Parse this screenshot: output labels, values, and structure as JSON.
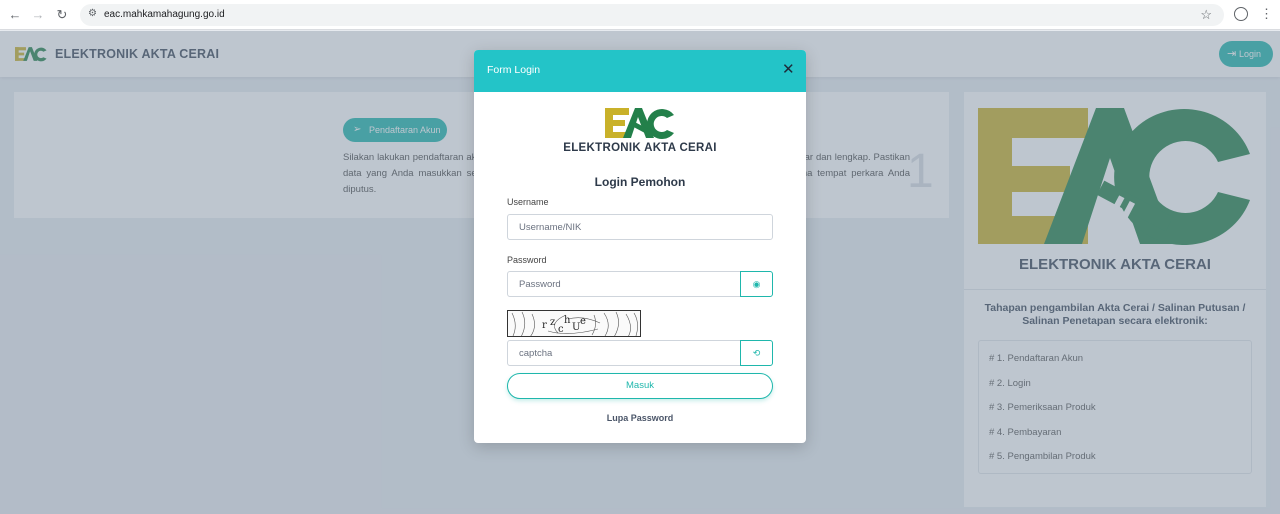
{
  "browser": {
    "url": "eac.mahkamahagung.go.id"
  },
  "header": {
    "title": "ELEKTRONIK AKTA CERAI",
    "login_label": "Login"
  },
  "registration_card": {
    "button_label": "Pendaftaran Akun",
    "text": "Silakan lakukan pendaftaran akun terlebih dahulu dengan mengisi dan melengkapi data diri Anda secara benar dan lengkap. Pastikan data yang Anda masukkan sesuai dengan data yang terdaftar di Mahkamah Syar'iyah/Pengadilan Agama tempat perkara Anda diputus.",
    "step_number": "1"
  },
  "side_card": {
    "logo_title": "ELEKTRONIK AKTA CERAI",
    "steps_heading": "Tahapan pengambilan Akta Cerai / Salinan Putusan / Salinan Penetapan secara elektronik:",
    "steps": [
      "# 1. Pendaftaran Akun",
      "# 2. Login",
      "# 3. Pemeriksaan Produk",
      "# 4. Pembayaran",
      "# 5. Pengambilan Produk"
    ]
  },
  "modal": {
    "title": "Form Login",
    "close_symbol": "✕",
    "brand": "ELEKTRONIK AKTA CERAI",
    "heading": "Login Pemohon",
    "username_label": "Username",
    "username_placeholder": "Username/NIK",
    "password_label": "Password",
    "password_placeholder": "Password",
    "captcha_placeholder": "captcha",
    "submit_label": "Masuk",
    "forgot_label": "Lupa Password"
  },
  "icons": {
    "back": "back-arrow-icon",
    "forward": "forward-arrow-icon",
    "reload": "reload-icon",
    "site_settings": "site-settings-icon",
    "bookmark": "star-icon",
    "profile": "profile-icon",
    "menu": "kebab-menu-icon",
    "login": "login-icon",
    "register": "register-icon",
    "eye": "eye-icon",
    "refresh": "refresh-icon",
    "close": "close-icon"
  },
  "colors": {
    "accent_teal": "#1fb7ac",
    "modal_header": "#23c4c8",
    "logo_yellow": "#c9b12a",
    "logo_green": "#23804a",
    "text_dark": "#3c4858"
  }
}
